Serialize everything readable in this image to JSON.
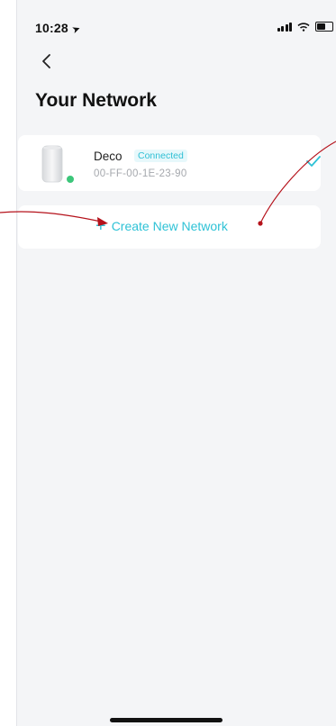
{
  "status_bar": {
    "time": "10:28",
    "location_icon": "location-arrow-icon"
  },
  "header": {
    "back_icon": "chevron-left-icon",
    "title": "Your Network"
  },
  "device": {
    "name": "Deco",
    "status": "Connected",
    "mac": "00-FF-00-1E-23-90",
    "status_color": "#3cc67a",
    "selected": true
  },
  "create": {
    "icon": "plus-icon",
    "label": "Create New Network"
  },
  "colors": {
    "accent": "#2ec2d6",
    "annotation": "#b5121b"
  }
}
